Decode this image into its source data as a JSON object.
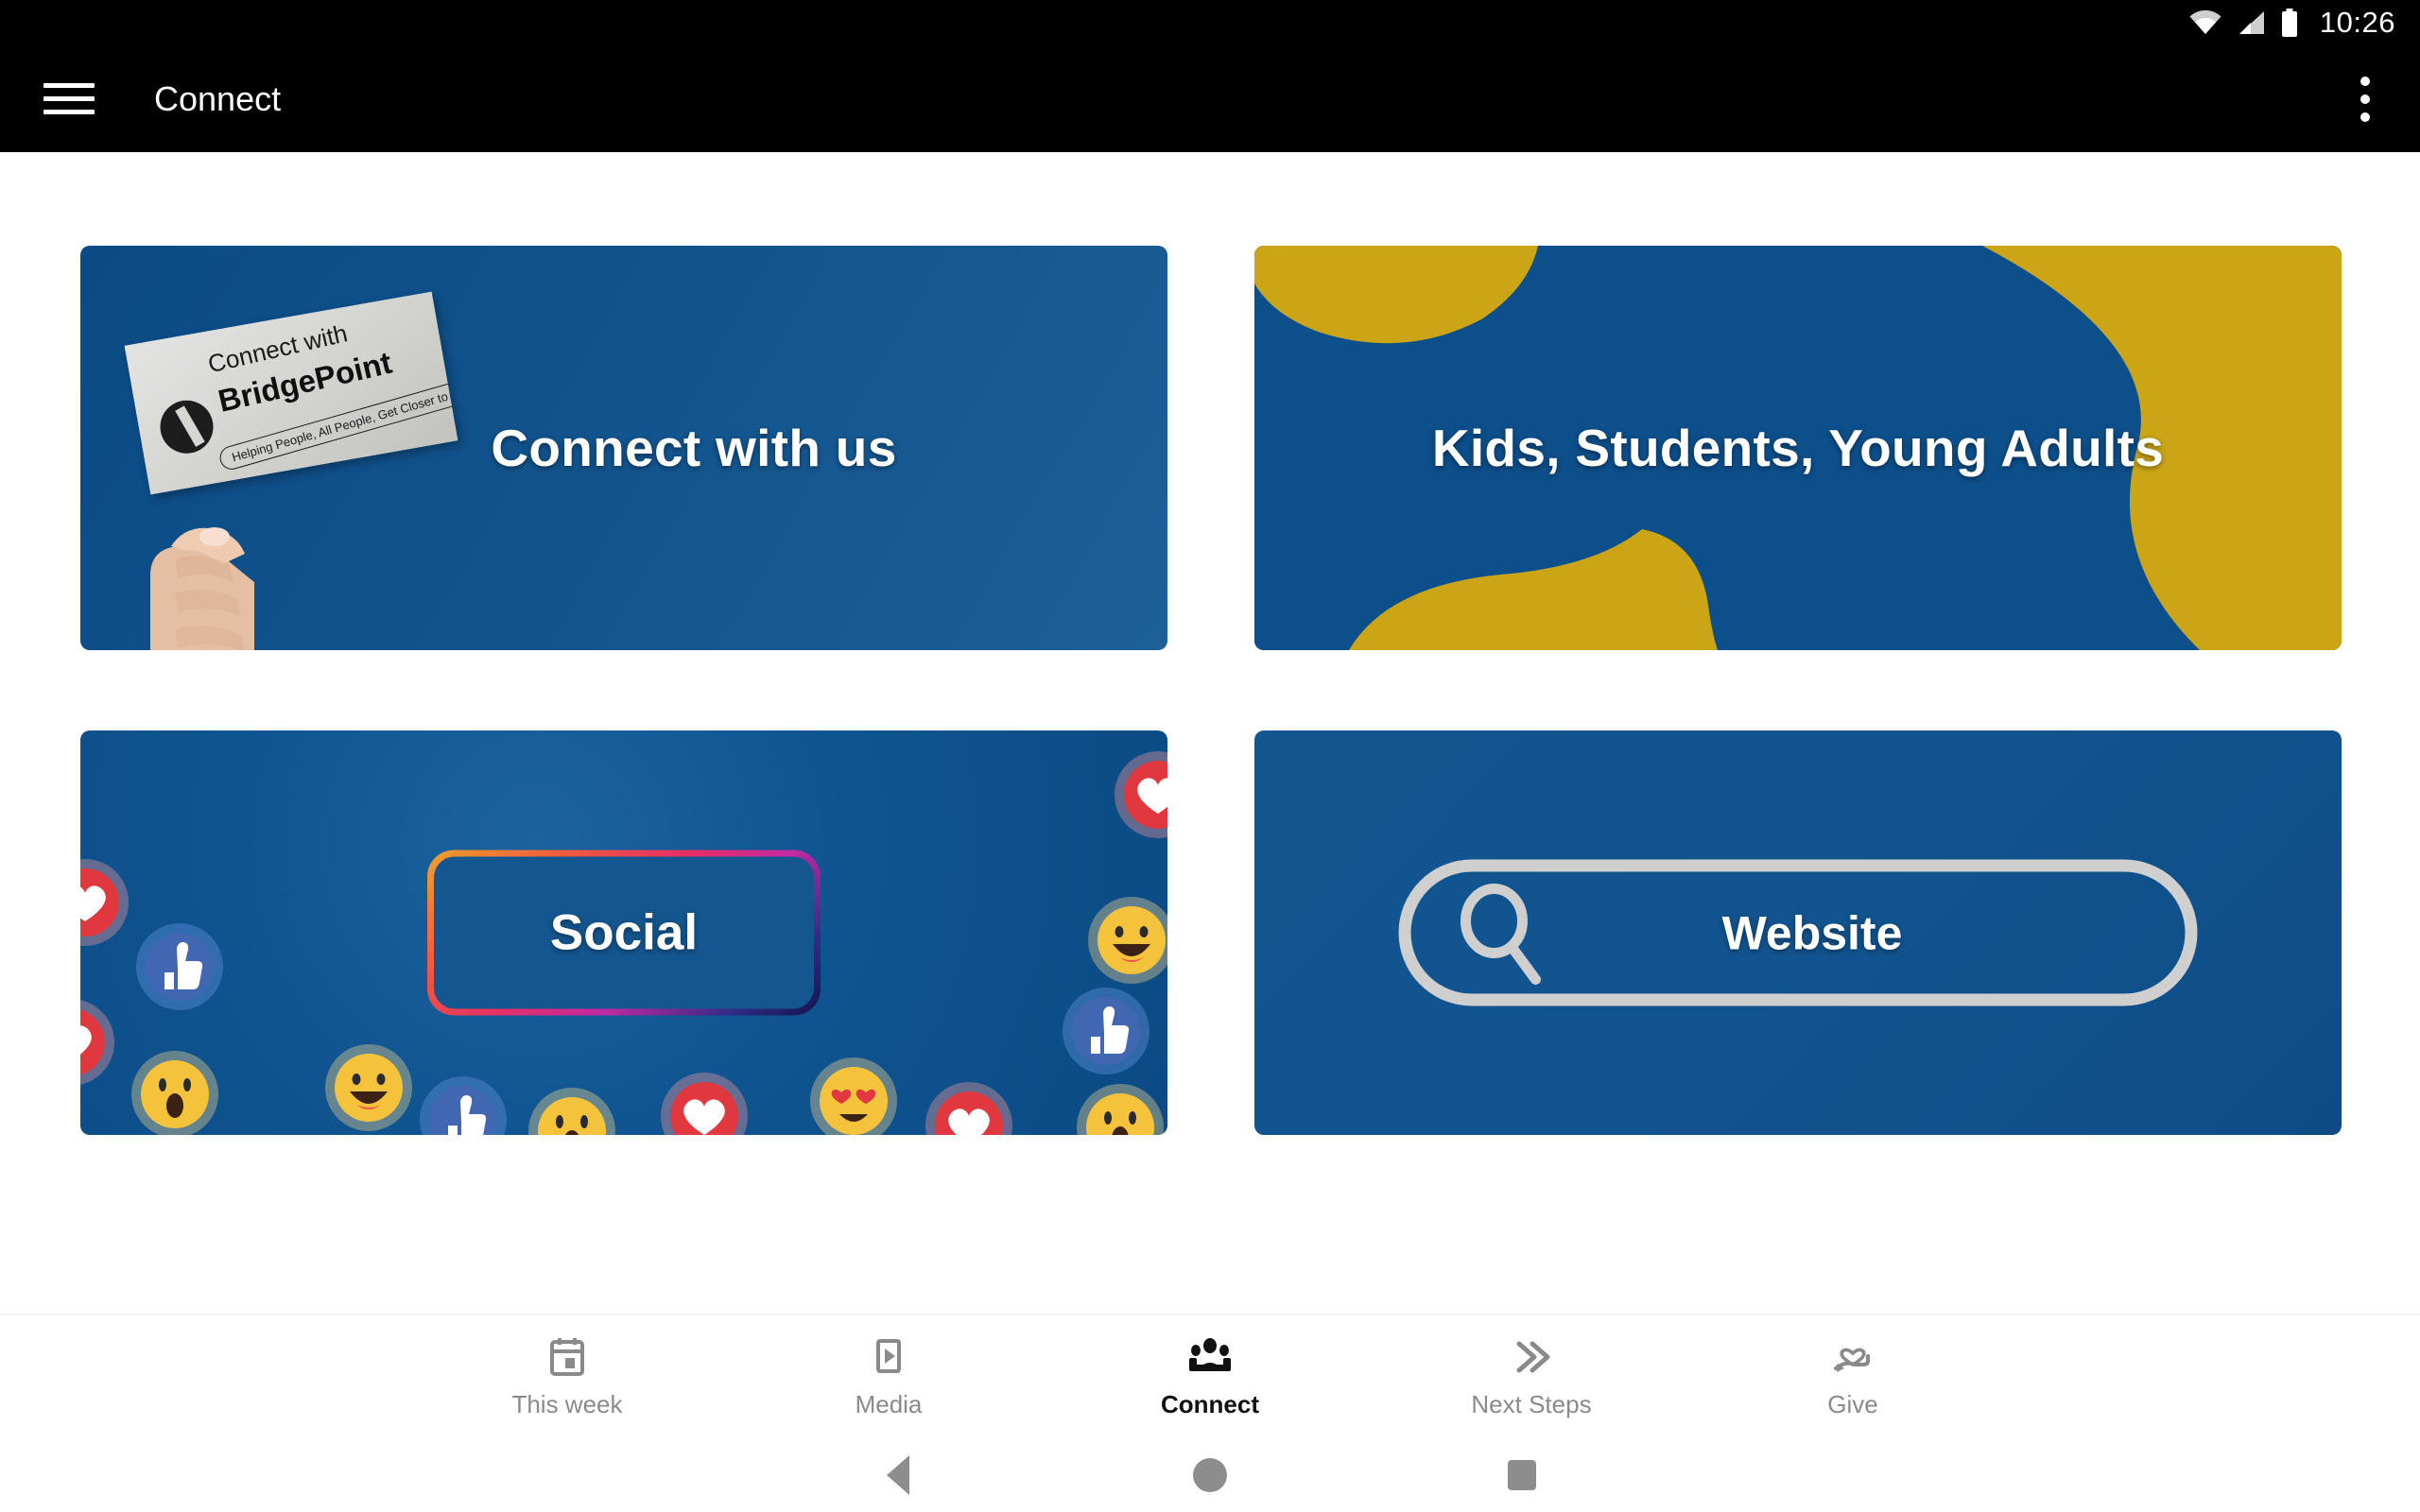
{
  "status_bar": {
    "time": "10:26",
    "icons": [
      "wifi-icon",
      "cellular-signal-icon",
      "battery-icon"
    ]
  },
  "toolbar": {
    "menu_icon": "hamburger-menu-icon",
    "title": "Connect",
    "overflow_icon": "more-vertical-icon"
  },
  "cards": [
    {
      "title": "Connect with us",
      "image": "hand-holding-connect-card-photo",
      "sign_line1": "Connect with",
      "sign_line2": "BridgePoint",
      "sign_tagline": "Helping People, All People, Get Closer to God",
      "bg_color": "#0d4f8b"
    },
    {
      "title": "Kids, Students, Young Adults",
      "image": "yellow-blob-shapes-graphic",
      "bg_color": "#0d4f8b",
      "accent_color": "#cba516"
    },
    {
      "title": "Social",
      "image": "facebook-reaction-emojis-graphic",
      "bg_color": "#0f5490",
      "frame_gradient": "instagram-gradient"
    },
    {
      "title": "Website",
      "image": "search-bar-outline-graphic",
      "bg_color": "#125490",
      "search_icon": "magnifying-glass-icon"
    }
  ],
  "bottom_nav": {
    "active": "Connect",
    "items": [
      {
        "label": "This week",
        "icon": "calendar-icon"
      },
      {
        "label": "Media",
        "icon": "play-rectangle-icon"
      },
      {
        "label": "Connect",
        "icon": "people-group-icon"
      },
      {
        "label": "Next Steps",
        "icon": "double-chevron-right-icon"
      },
      {
        "label": "Give",
        "icon": "hand-heart-icon"
      }
    ]
  },
  "system_nav": {
    "back": "back-triangle-icon",
    "home": "home-circle-icon",
    "recents": "recents-square-icon"
  },
  "colors": {
    "brand_blue": "#0d4f8b",
    "brand_yellow": "#cba516",
    "toolbar_bg": "#000000",
    "page_bg": "#ffffff"
  }
}
